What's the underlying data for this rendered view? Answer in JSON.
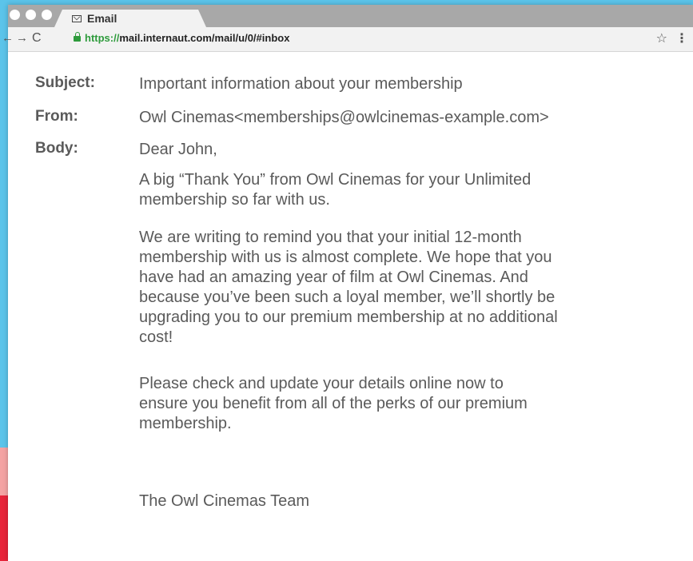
{
  "browser": {
    "tab_title": "Email",
    "url_scheme": "https://",
    "url_rest": "mail.internaut.com/mail/u/0/#inbox",
    "nav": {
      "back": "←",
      "forward": "→",
      "reload": "C"
    },
    "star": "☆",
    "menu": "⋮"
  },
  "email": {
    "subject_label": "Subject:",
    "subject": "Important information about your membership",
    "from_label": "From:",
    "from": "Owl Cinemas<memberships@owlcinemas-example.com>",
    "body_label": "Body:",
    "greeting": "Dear John,",
    "paragraphs": [
      "A big “Thank You” from Owl Cinemas for your Unlimited membership so far with us.",
      "We are writing to remind you that your initial 12-month membership with us is almost complete. We hope that you have had an amazing year of film at Owl Cinemas. And because you’ve been such a loyal member, we’ll shortly be upgrading you to our premium membership at no additional cost!",
      "Please check and update your details online now to ensure you benefit from all of the perks of our premium membership."
    ],
    "signature": "The Owl Cinemas Team"
  }
}
